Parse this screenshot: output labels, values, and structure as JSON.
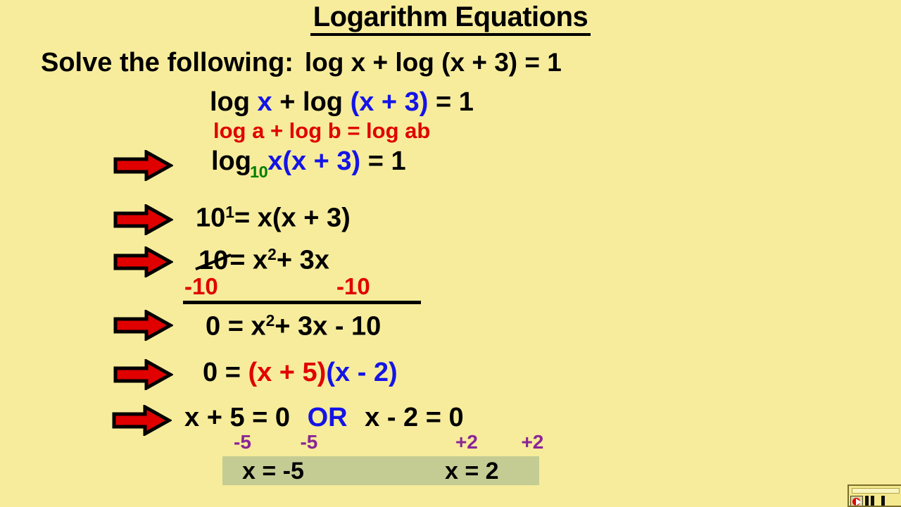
{
  "slide": {
    "title": "Logarithm Equations",
    "background_color": "#f7ec9b",
    "prompt_label": "Solve the following:",
    "prompt_equation": "log x + log (x + 3) = 1"
  },
  "colors": {
    "black": "#000000",
    "blue": "#1414e6",
    "red": "#e00000",
    "green": "#008000",
    "purple": "#8a2596",
    "answer_box": "#c4cc94",
    "page": "#f7ec9b"
  },
  "steps": {
    "line2": {
      "log1": "log",
      "x": "x",
      "plus": "+",
      "log2": "log",
      "group": "(x + 3)",
      "equals": "= 1"
    },
    "rule": {
      "text": "log a  +  log b  =  log ab"
    },
    "line4": {
      "log": "log",
      "base": "10",
      "product": "x(x + 3)",
      "equals": "= 1"
    },
    "line5": {
      "base": "10",
      "exponent": "1",
      "rest": "=   x(x + 3)"
    },
    "line6": {
      "cancelled": "10",
      "rest": "=   x",
      "exponent": "2",
      "tail": "+ 3x"
    },
    "line6_sub": {
      "left": "-10",
      "right": "-10"
    },
    "line7": {
      "lhs": "0   =   x",
      "exponent": "2",
      "tail": "+ 3x - 10"
    },
    "line8": {
      "lhs": "0   =  ",
      "factor1": "(x + 5)",
      "factor2": "(x - 2)"
    },
    "line9": {
      "eq1": "x + 5 = 0",
      "or": "OR",
      "eq2": "x - 2 = 0"
    },
    "line9_sub": {
      "a": "-5",
      "b": "-5",
      "c": "+2",
      "d": "+2"
    }
  },
  "answers": {
    "solution1": "x = -5",
    "solution2": "x = 2"
  },
  "arrows": {
    "count": 6,
    "icon": "right-block-arrow-icon",
    "fill": "#e00000",
    "stroke": "#000000"
  },
  "widget": {
    "name": "media-playback-bar",
    "record_icon": "record-play-icon",
    "pause_icon": "pause-icon",
    "stop_icon": "stop-icon"
  }
}
